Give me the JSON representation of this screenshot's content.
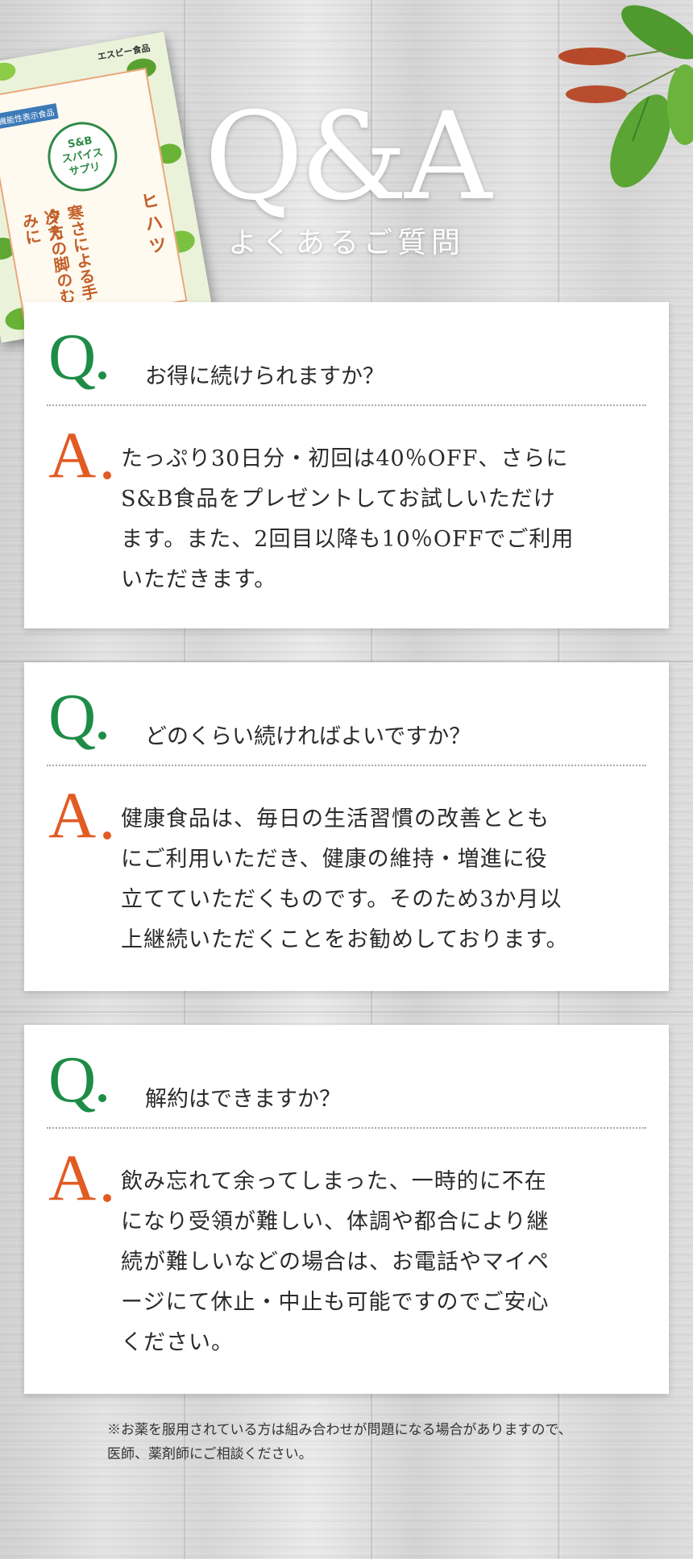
{
  "header": {
    "title": "Q&A",
    "subtitle": "よくあるご質問"
  },
  "package": {
    "brand": "エスビー食品",
    "badge": "機能性表示食品",
    "logo_line1": "S&B",
    "logo_line2": "スパイス",
    "logo_line3": "サプリ",
    "product_name": "ヒハツ",
    "claim_line1": "寒さによる手の冷え",
    "claim_line2": "夕方の脚のむくみに"
  },
  "qa": [
    {
      "q_mark": "Q",
      "question": "お得に続けられますか？",
      "a_mark": "A",
      "answer_lines": [
        "たっぷり30日分・初回は40％OFF、さらに",
        "S&B食品をプレゼントしてお試しいただけ",
        "ます。また、2回目以降も10％OFFでご利用",
        "いただきます。"
      ]
    },
    {
      "q_mark": "Q",
      "question": "どのくらい続ければよいですか？",
      "a_mark": "A",
      "answer_lines": [
        "健康食品は、毎日の生活習慣の改善ととも",
        "にご利用いただき、健康の維持・増進に役",
        "立てていただくものです。そのため3か月以",
        "上継続いただくことをお勧めしております。"
      ]
    },
    {
      "q_mark": "Q",
      "question": "解約はできますか？",
      "a_mark": "A",
      "answer_lines": [
        "飲み忘れて余ってしまった、一時的に不在",
        "になり受領が難しい、体調や都合により継",
        "続が難しいなどの場合は、お電話やマイペ",
        "ージにて休止・中止も可能ですのでご安心",
        "ください。"
      ]
    }
  ],
  "note_lines": [
    "※お薬を服用されている方は組み合わせが問題になる場合がありますので、",
    "医師、薬剤師にご相談ください。"
  ],
  "colors": {
    "q_green": "#1e8c47",
    "a_orange": "#e15b23"
  }
}
